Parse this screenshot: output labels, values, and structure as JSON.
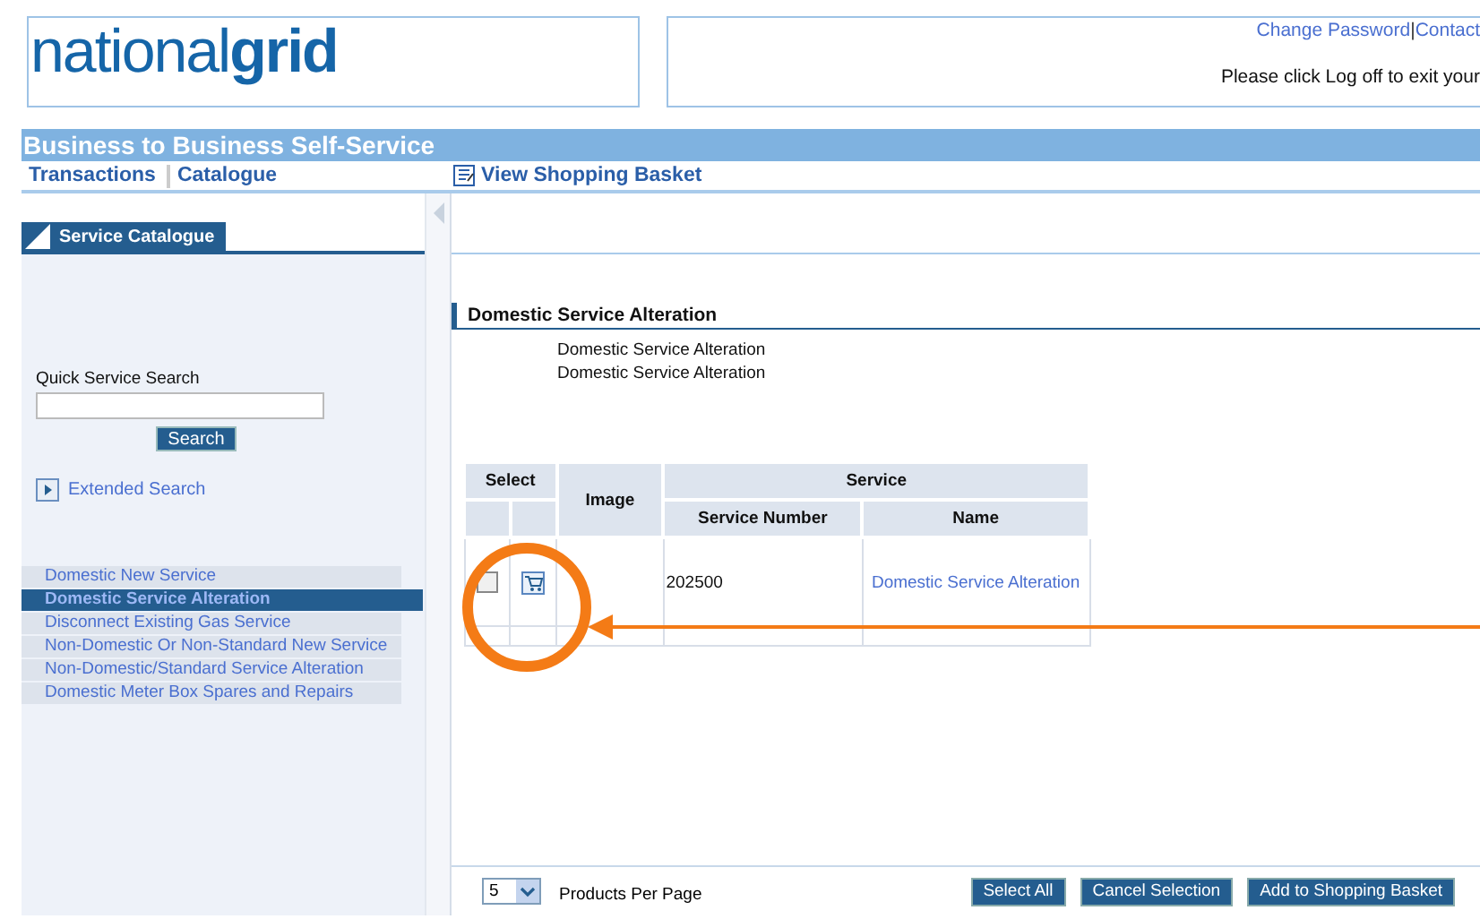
{
  "logo": {
    "light": "national",
    "bold": "grid"
  },
  "header_links": [
    "Change Password",
    "Contact"
  ],
  "header_separator": "|",
  "logoff_note": "Please click Log off to exit your",
  "title": "Business to Business Self-Service",
  "nav_tabs": [
    "Transactions",
    "Catalogue"
  ],
  "basket_link": "View Shopping Basket",
  "sidebar": {
    "tab": "Service Catalogue",
    "search_label": "Quick Service Search",
    "search_button": "Search",
    "extended_search": "Extended Search",
    "items": [
      {
        "label": "Domestic New Service",
        "selected": false
      },
      {
        "label": "Domestic Service Alteration",
        "selected": true
      },
      {
        "label": "Disconnect Existing Gas Service",
        "selected": false
      },
      {
        "label": "Non-Domestic Or Non-Standard New Service",
        "selected": false
      },
      {
        "label": "Non-Domestic/Standard Service Alteration",
        "selected": false
      },
      {
        "label": "Domestic Meter Box Spares and Repairs",
        "selected": false
      }
    ]
  },
  "section": {
    "title": "Domestic Service Alteration",
    "description": [
      "Domestic Service Alteration",
      "Domestic Service Alteration"
    ]
  },
  "table": {
    "select_header": "Select",
    "image_header": "Image",
    "service_header": "Service",
    "columns": [
      "Service Number",
      "Name"
    ],
    "rows": [
      {
        "checked": false,
        "service_number": "202500",
        "name": "Domestic Service Alteration"
      }
    ]
  },
  "pager": {
    "per_page": "5",
    "label": "Products Per Page"
  },
  "buttons": [
    "Select All",
    "Cancel Selection",
    "Add to Shopping Basket"
  ]
}
